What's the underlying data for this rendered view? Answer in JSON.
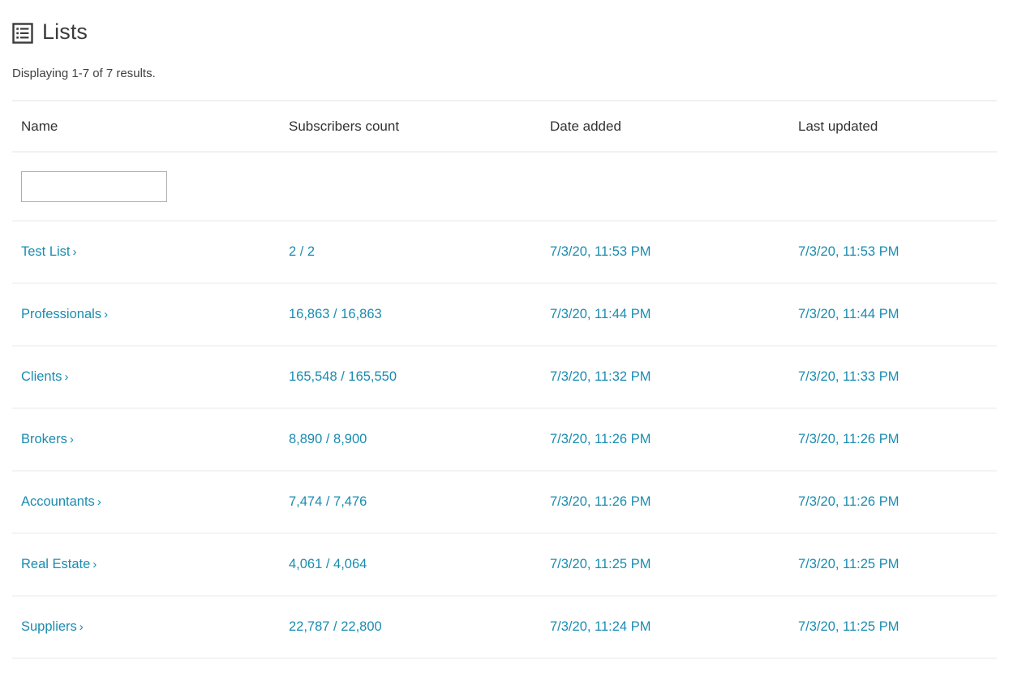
{
  "header": {
    "title": "Lists",
    "icon": "list-table-icon"
  },
  "summary": "Displaying 1-7 of 7 results.",
  "colors": {
    "link": "#1a8cb0",
    "text": "#333333",
    "border": "#f4f4f4",
    "input_border": "#adadad"
  },
  "table": {
    "columns": [
      {
        "key": "name",
        "label": "Name"
      },
      {
        "key": "subscribers",
        "label": "Subscribers count"
      },
      {
        "key": "date_added",
        "label": "Date added"
      },
      {
        "key": "last_updated",
        "label": "Last updated"
      }
    ],
    "filters": {
      "name": {
        "value": "",
        "placeholder": ""
      }
    },
    "rows": [
      {
        "name": "Test List",
        "chevron": "›",
        "subscribers": "2 / 2",
        "date_added": "7/3/20, 11:53 PM",
        "last_updated": "7/3/20, 11:53 PM"
      },
      {
        "name": "Professionals",
        "chevron": "›",
        "subscribers": "16,863 / 16,863",
        "date_added": "7/3/20, 11:44 PM",
        "last_updated": "7/3/20, 11:44 PM"
      },
      {
        "name": "Clients",
        "chevron": "›",
        "subscribers": "165,548 / 165,550",
        "date_added": "7/3/20, 11:32 PM",
        "last_updated": "7/3/20, 11:33 PM"
      },
      {
        "name": "Brokers",
        "chevron": "›",
        "subscribers": "8,890 / 8,900",
        "date_added": "7/3/20, 11:26 PM",
        "last_updated": "7/3/20, 11:26 PM"
      },
      {
        "name": "Accountants",
        "chevron": "›",
        "subscribers": "7,474 / 7,476",
        "date_added": "7/3/20, 11:26 PM",
        "last_updated": "7/3/20, 11:26 PM"
      },
      {
        "name": "Real Estate",
        "chevron": "›",
        "subscribers": "4,061 / 4,064",
        "date_added": "7/3/20, 11:25 PM",
        "last_updated": "7/3/20, 11:25 PM"
      },
      {
        "name": "Suppliers",
        "chevron": "›",
        "subscribers": "22,787 / 22,800",
        "date_added": "7/3/20, 11:24 PM",
        "last_updated": "7/3/20, 11:25 PM"
      }
    ]
  }
}
